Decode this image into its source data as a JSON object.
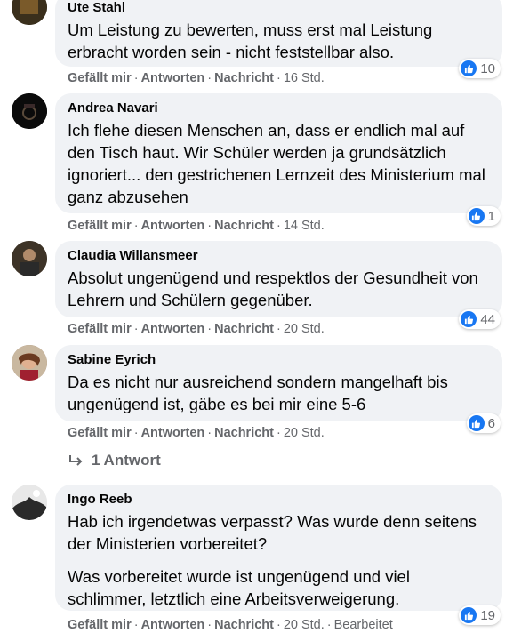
{
  "actions": {
    "like": "Gefällt mir",
    "reply": "Antworten",
    "message": "Nachricht",
    "sep": "·"
  },
  "comments": [
    {
      "author": "Ute Stahl",
      "text": [
        "Um Leistung zu bewerten, muss erst mal Leistung erbracht worden sein - nicht feststellbar also."
      ],
      "time": "16 Std.",
      "reactions": "10"
    },
    {
      "author": "Andrea Navari",
      "text": [
        "Ich flehe diesen Menschen an, dass er endlich mal auf den Tisch haut. Wir Schüler werden ja grundsätzlich ignoriert... den gestrichenen Lernzeit des Ministerium mal ganz abzusehen"
      ],
      "time": "14 Std.",
      "reactions": "1"
    },
    {
      "author": "Claudia Willansmeer",
      "text": [
        "Absolut ungenügend und respektlos der Gesundheit von Lehrern und Schülern gegenüber."
      ],
      "time": "20 Std.",
      "reactions": "44"
    },
    {
      "author": "Sabine Eyrich",
      "text": [
        "Da es nicht nur ausreichend sondern mangelhaft bis ungenügend ist, gäbe es bei mir eine 5-6"
      ],
      "time": "20 Std.",
      "reactions": "6",
      "replies_label": "1 Antwort"
    },
    {
      "author": "Ingo Reeb",
      "text": [
        "Hab ich irgendetwas verpasst? Was wurde denn seitens der Ministerien vorbereitet?",
        "Was vorbereitet wurde ist ungenügend und viel schlimmer, letztlich eine Arbeitsverweigerung."
      ],
      "time": "20 Std.",
      "edited": "Bearbeitet",
      "reactions": "19"
    }
  ],
  "colors": {
    "bubble": "#f0f2f5",
    "like_blue": "#1877f2",
    "meta_gray": "#65676b"
  },
  "icons": {
    "like": "thumbs-up-icon",
    "reply_arrow": "reply-arrow-icon"
  }
}
